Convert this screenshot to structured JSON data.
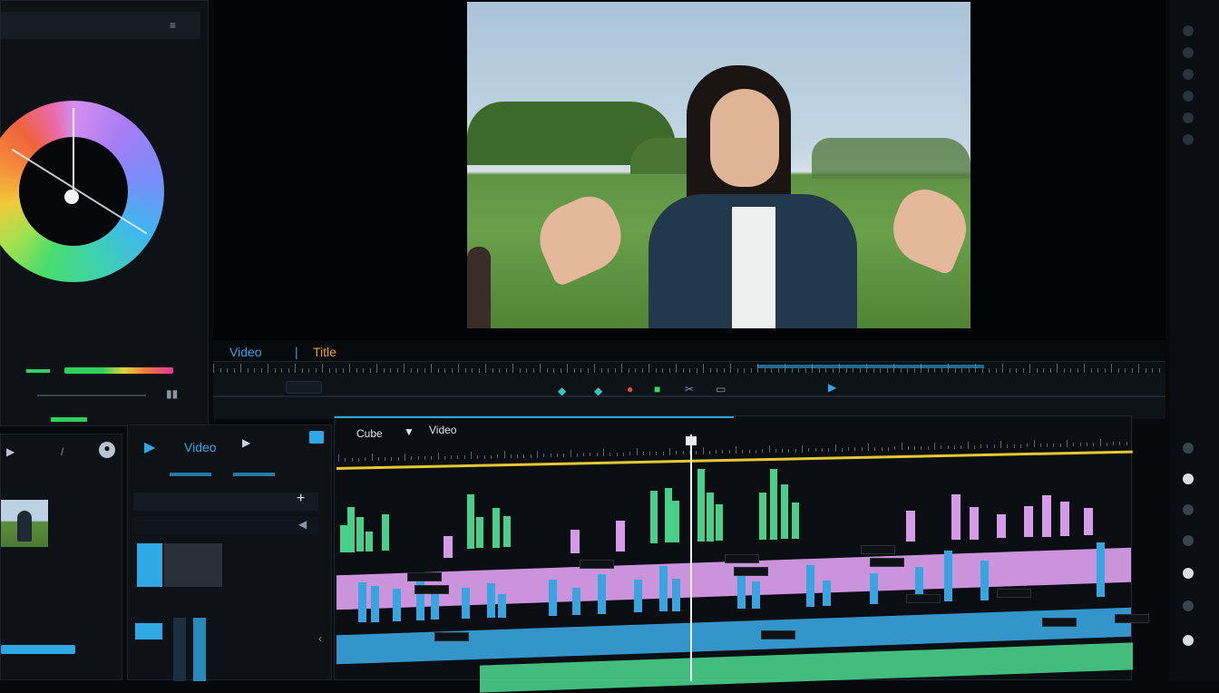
{
  "top_left_header": "",
  "color_panel": {
    "readout_left": "",
    "readout_center": "",
    "readout_right": "",
    "meter_left": "",
    "meter_right": ""
  },
  "viewer": {
    "label_video": "Video",
    "label_title": "Title",
    "timecode_1": "",
    "timecode_2": "",
    "timecode_3": "",
    "toolbar_left": ""
  },
  "project_panel": {
    "tab_label": "Video",
    "item_label": "",
    "bin_label": "",
    "list_items": [
      "",
      "",
      ""
    ]
  },
  "timeline": {
    "tab_cube": "Cube",
    "tab_video": "Video",
    "ruler_labels": [
      "",
      "",
      "",
      "",
      "",
      "",
      "",
      ""
    ]
  },
  "colors": {
    "accent_blue": "#2fa8e6",
    "title_orange": "#f0a030",
    "track_pink": "#d69be8",
    "track_blue": "#39a4e0",
    "track_green": "#48d08a",
    "playhead": "#e8eef2",
    "in_out_bar": "#e6c833"
  },
  "icons": [
    "play-icon",
    "scissors-icon",
    "link-icon",
    "magnet-icon",
    "marker-icon",
    "plus-icon",
    "gear-icon",
    "folder-icon"
  ]
}
